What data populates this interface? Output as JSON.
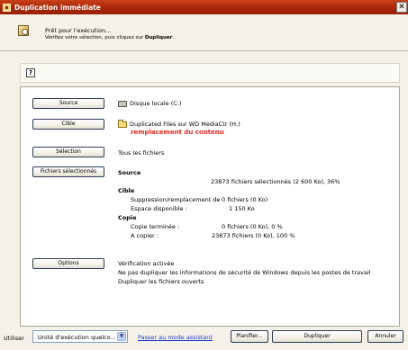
{
  "window": {
    "title": "Duplication immédiate",
    "close_glyph": "✕"
  },
  "header": {
    "line1": "Prêt pour l'exécution...",
    "line2_prefix": "Vérifiez votre sélection, puis cliquez sur ",
    "line2_action": "Dupliquer",
    "line2_suffix": "."
  },
  "help": {
    "glyph": "?"
  },
  "panel": {
    "source_button": "Source",
    "source_value": "Disque locale (C:)",
    "cible_button": "Cible",
    "cible_value": "Duplicated Files sur WD MediaCtr (H:)",
    "cible_warning": "remplacement du contenu",
    "selection_button": "Sélection",
    "selection_value": "Tous les fichiers",
    "fichiers_button": "Fichiers sélectionnés",
    "summary": {
      "source_heading": "Source",
      "source_stats": "23873 fichiers sélectionnés (2 600 Ko), 36%",
      "cible_heading": "Cible",
      "suppression_label": "Suppression/remplacement de",
      "suppression_value": "0 fichiers (0 Ko)",
      "espace_label": "Espace disponible :",
      "espace_value": "1 150 Ko",
      "copie_heading": "Copie",
      "copie_terminee_label": "Copie terminée :",
      "copie_terminee_value": "0 fichiers (0 Ko), 0 %",
      "a_copier_label": "A copier :",
      "a_copier_value": "23873  fichiers (0 Ko), 100 %"
    },
    "options_button": "Options",
    "options_lines": [
      "Vérification activée",
      "Ne pas dupliquer les informations de sécurité de Windows depuis les postes de travail",
      "Dupliquer les fichiers ouverts"
    ]
  },
  "footer": {
    "utiliser_label": "Utiliser",
    "unit_select": "Unité d'exécution quelco...",
    "assistant_link": "Passer au mode assistant",
    "planifier_button": "Planifier...",
    "dupliquer_button": "Dupliquer",
    "annuler_button": "Annuler"
  }
}
